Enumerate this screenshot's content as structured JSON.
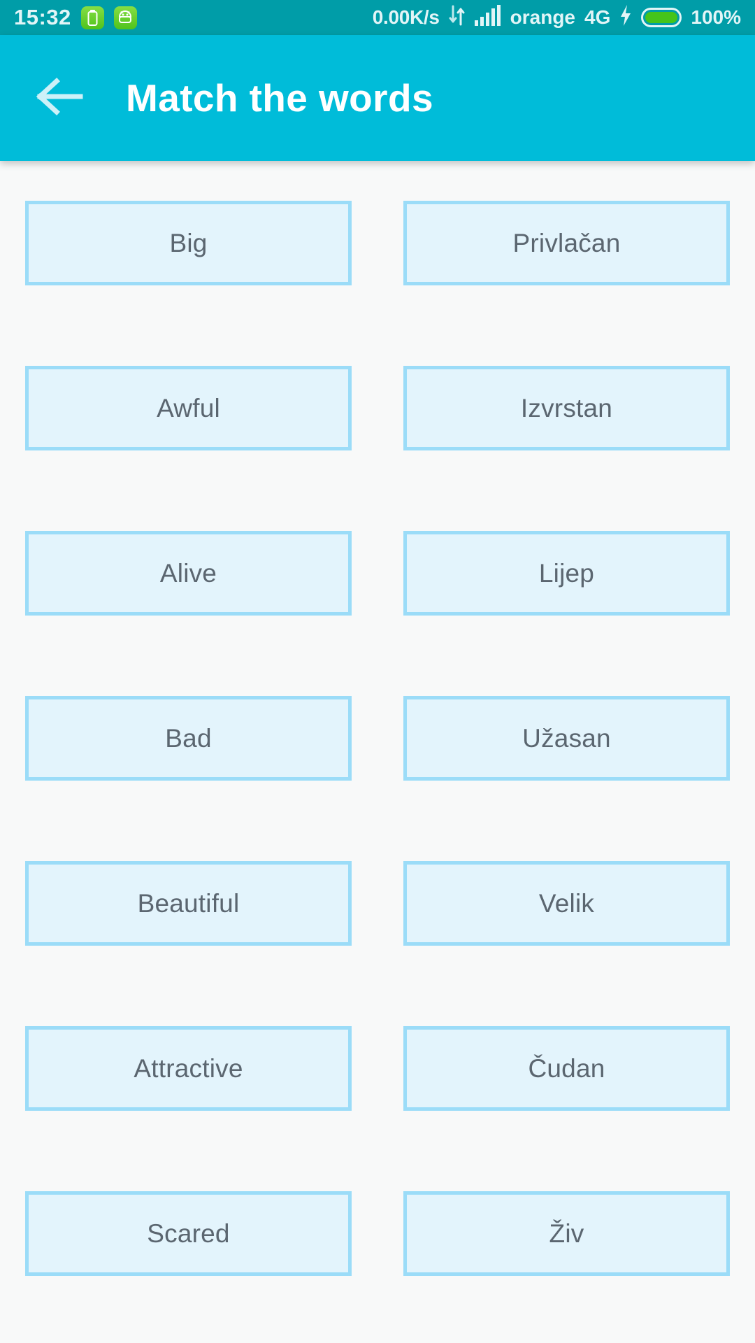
{
  "statusbar": {
    "time": "15:32",
    "battery_saver_icon": "battery-icon",
    "android_icon": "android-robot-icon",
    "network_speed": "0.00K/s",
    "data_transfer_icon": "data-transfer-arrows-icon",
    "signal_icon": "signal-bars-icon",
    "carrier": "orange",
    "network_type": "4G",
    "charging_icon": "lightning-bolt-icon",
    "battery_icon": "battery-full-icon",
    "battery_percent": "100%"
  },
  "appbar": {
    "back_icon": "back-arrow-icon",
    "title": "Match the words",
    "background_color": "#00BCD9"
  },
  "theme": {
    "statusbar_color": "#009DA8",
    "accent_color": "#00BCD9",
    "card_border_color": "#9BDCF8",
    "card_fill_color": "#E3F4FC",
    "card_text_color": "#5B6670",
    "page_background": "#F8F9F9"
  },
  "rows": [
    {
      "left": "Big",
      "right": "Privlačan"
    },
    {
      "left": "Awful",
      "right": "Izvrstan"
    },
    {
      "left": "Alive",
      "right": "Lijep"
    },
    {
      "left": "Bad",
      "right": "Užasan"
    },
    {
      "left": "Beautiful",
      "right": "Velik"
    },
    {
      "left": "Attractive",
      "right": "Čudan"
    },
    {
      "left": "Scared",
      "right": "Živ"
    }
  ]
}
